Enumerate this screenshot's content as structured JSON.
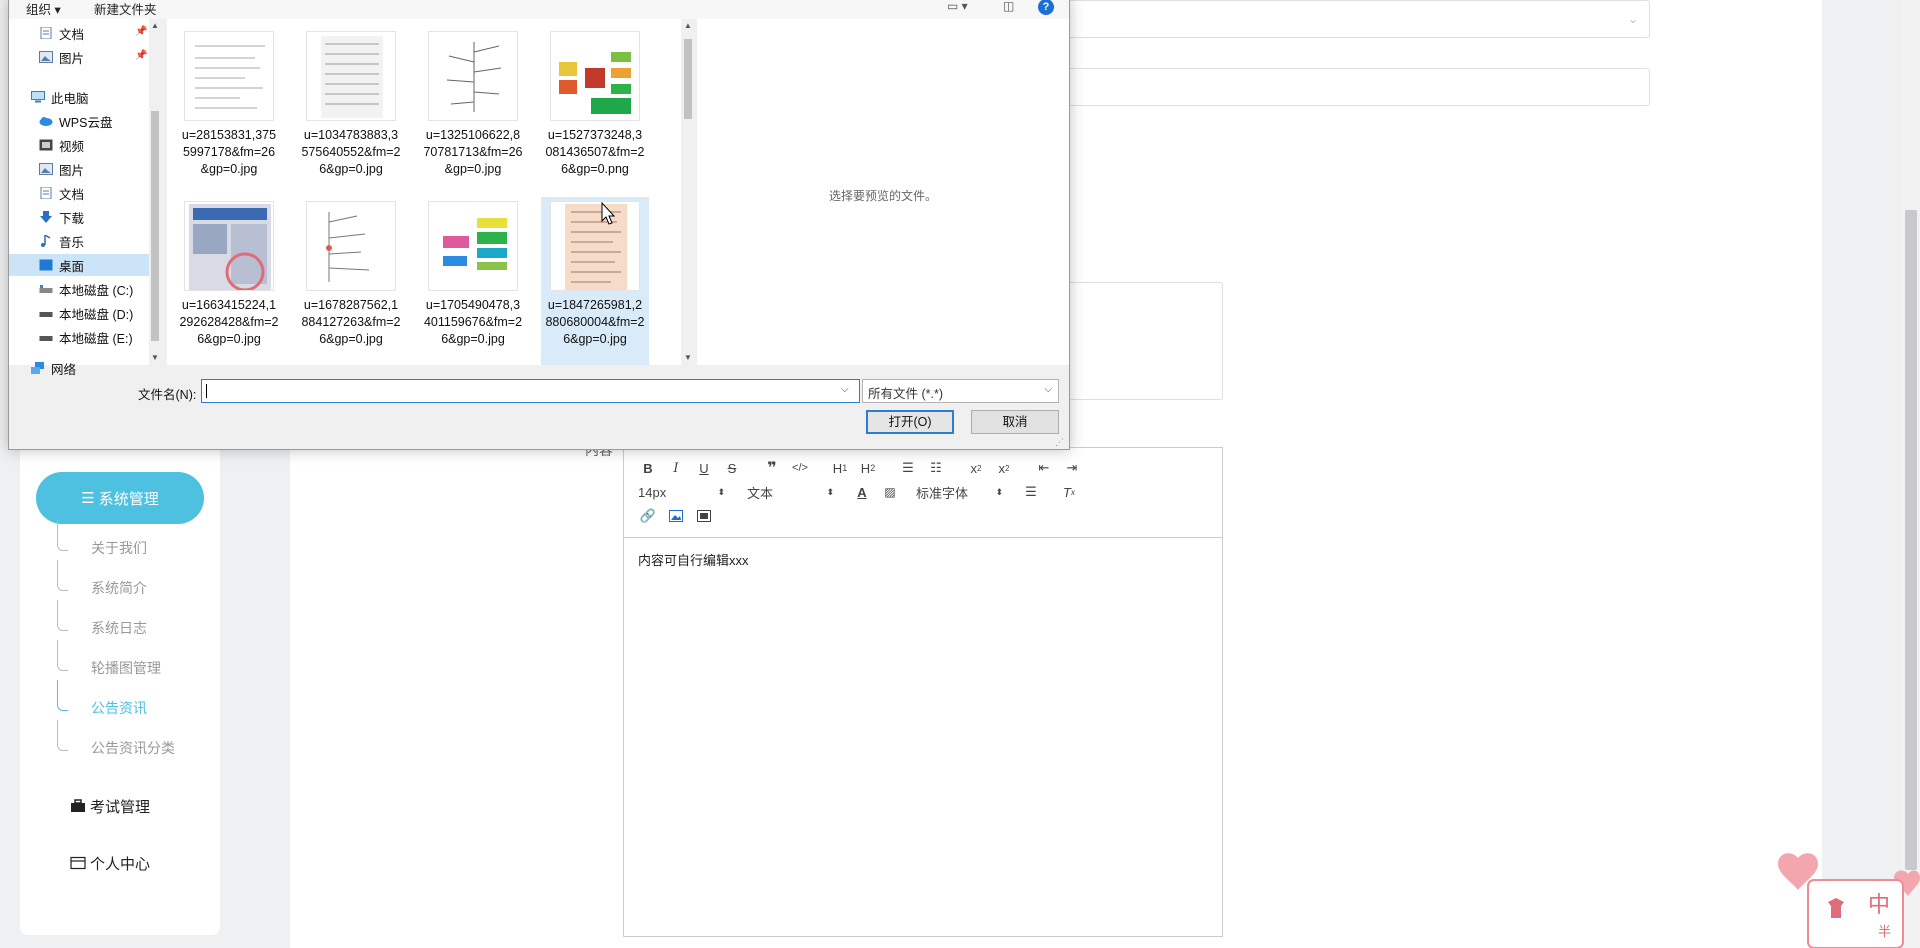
{
  "dialog": {
    "toolbar": {
      "organize": "组织 ▾",
      "new_folder": "新建文件夹",
      "help": "?"
    },
    "nav_items": [
      {
        "label": "文档",
        "icon": "documents-icon",
        "pinned": true
      },
      {
        "label": "图片",
        "icon": "pictures-icon",
        "pinned": true
      },
      {
        "label": "此电脑",
        "icon": "this-pc-icon"
      },
      {
        "label": "WPS云盘",
        "icon": "cloud-icon"
      },
      {
        "label": "视频",
        "icon": "videos-icon"
      },
      {
        "label": "图片",
        "icon": "pictures-icon"
      },
      {
        "label": "文档",
        "icon": "documents-icon"
      },
      {
        "label": "下载",
        "icon": "downloads-icon"
      },
      {
        "label": "音乐",
        "icon": "music-icon"
      },
      {
        "label": "桌面",
        "icon": "desktop-icon",
        "selected": true
      },
      {
        "label": "本地磁盘 (C:)",
        "icon": "drive-icon"
      },
      {
        "label": "本地磁盘 (D:)",
        "icon": "drive-icon"
      },
      {
        "label": "本地磁盘 (E:)",
        "icon": "drive-icon"
      },
      {
        "label": "网络",
        "icon": "network-icon"
      }
    ],
    "files": [
      {
        "name": "u=28153831,3755997178&fm=26&gp=0.jpg"
      },
      {
        "name": "u=1034783883,3575640552&fm=26&gp=0.jpg"
      },
      {
        "name": "u=1325106622,870781713&fm=26&gp=0.jpg"
      },
      {
        "name": "u=1527373248,3081436507&fm=26&gp=0.png"
      },
      {
        "name": "u=1663415224,1292628428&fm=26&gp=0.jpg"
      },
      {
        "name": "u=1678287562,1884127263&fm=26&gp=0.jpg"
      },
      {
        "name": "u=1705490478,3401159676&fm=26&gp=0.jpg"
      },
      {
        "name": "u=1847265981,2880680004&fm=26&gp=0.jpg",
        "selected": true
      }
    ],
    "preview_text": "选择要预览的文件。",
    "filename_label": "文件名(N):",
    "filename_value": "",
    "filetype_value": "所有文件 (*.*)",
    "open_label": "打开(O)",
    "cancel_label": "取消"
  },
  "sidebar": {
    "active_menu": "系统管理",
    "sub_items": [
      {
        "label": "关于我们"
      },
      {
        "label": "系统简介"
      },
      {
        "label": "系统日志"
      },
      {
        "label": "轮播图管理"
      },
      {
        "label": "公告资讯",
        "active": true
      },
      {
        "label": "公告资讯分类"
      }
    ],
    "menu_exam": "考试管理",
    "menu_profile": "个人中心"
  },
  "editor": {
    "label": "内容",
    "font_size": "14px",
    "header_select": "文本",
    "font_select": "标准字体",
    "content": "内容可自行编辑xxx"
  },
  "sticker": {
    "char1": "中",
    "char2": "半"
  }
}
